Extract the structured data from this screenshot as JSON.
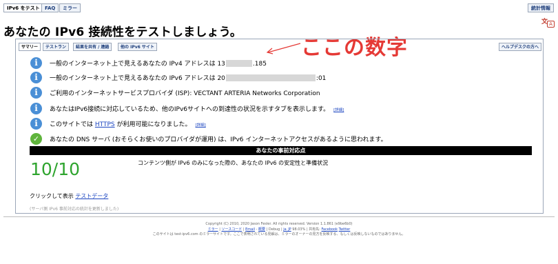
{
  "top_tabs": {
    "ipv6_test": "IPv6 をテスト",
    "faq": "FAQ",
    "mirror": "ミラー",
    "stats": "統計情報"
  },
  "page_title": "あなたの IPv6 接続性をテストしましょう。",
  "annotation": "ここの数字",
  "sub_tabs": {
    "summary": "サマリー",
    "test_run": "テストラン",
    "share": "結果を共有 / 連絡",
    "other": "他の IPv6 サイト",
    "help": "ヘルプデスクの方へ"
  },
  "rows": [
    {
      "prefix": "一般のインターネット上で見えるあなたの IPv4 アドレスは 13",
      "suffix": ".185"
    },
    {
      "prefix": "一般のインターネット上で見えるあなたの IPv6 アドレスは 20",
      "suffix": ":01"
    },
    {
      "text": "ご利用のインターネットサービスプロバイダ (ISP): VECTANT ARTERIA Networks Corporation"
    },
    {
      "text": "あなたはIPv6接続に対応しているため、他のIPv6サイトへの到達性の状況を示すタブを表示します。",
      "link": "[詳細]"
    },
    {
      "prefix": "このサイトでは",
      "link_text": "HTTPS",
      "suffix": "が利用可能になりました。",
      "link": "[詳細]"
    },
    {
      "text": "あなたの DNS サーバ (おそらくお使いのプロバイダが運用) は、IPv6 インターネットアクセスがあるように思われます。"
    }
  ],
  "banner": "あなたの事前対応点",
  "score": "10/10",
  "score_desc": "コンテンツ側が IPv6 のみになった際の、あなたの IPv6 の安定性と準備状況",
  "click_prefix": "クリックして表示",
  "test_data_link": "テストデータ",
  "update_note": "(サーバ側 IPv6 事前対応の統計を更新しました)",
  "footer": {
    "line1": "Copyright (C) 2010, 2020 Jason Fesler. All rights reserved. Version 1.1.861 (e9be6b0)",
    "links": [
      "ミラー",
      "ソースコード",
      "Email",
      "-",
      "概要",
      "Debug",
      "ja_JP",
      "98.03%",
      "共有先:",
      "Facebook",
      "Twitter"
    ],
    "line3": "このサイトは test-ipv6.com のミラーサイトです。ここで表明されている見解は、ミラーのオーナーの見方を反映する、もしくは反映しないものではありません。"
  },
  "colors": {
    "accent_link": "#1a44c0",
    "score_green": "#2ea42e",
    "annotation_red": "#e53935",
    "info_blue": "#4a8fd6",
    "ok_green": "#5fb43c"
  }
}
